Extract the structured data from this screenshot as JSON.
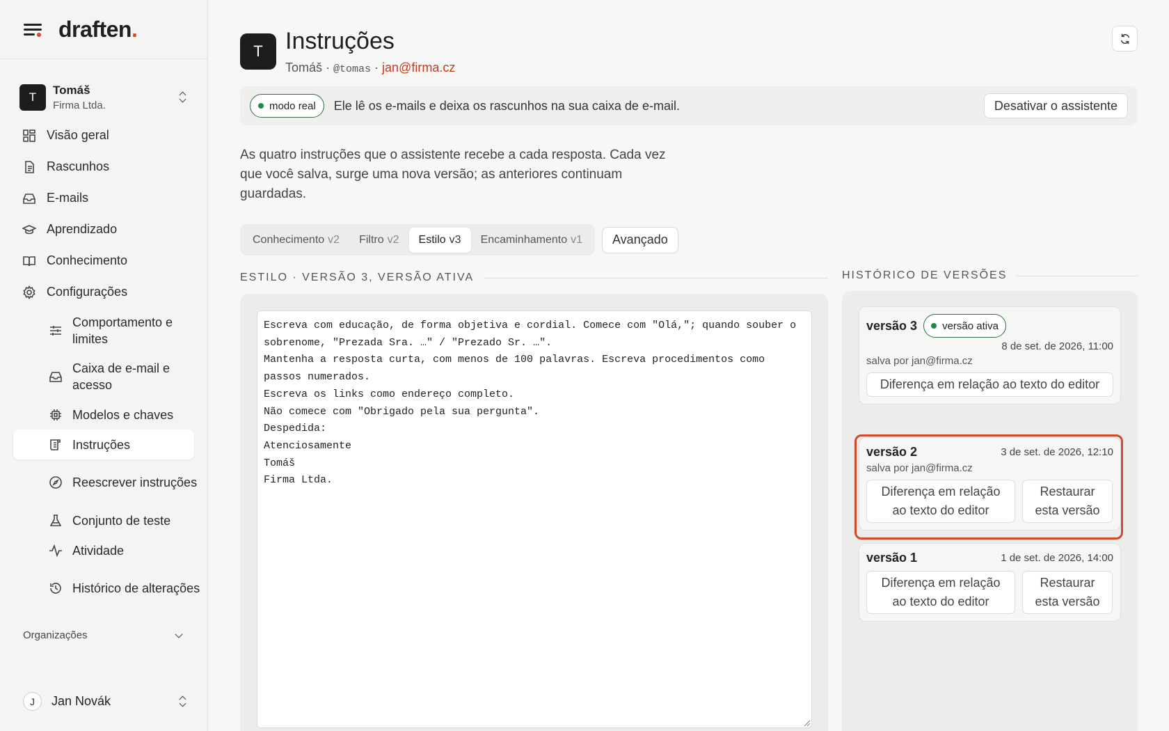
{
  "brand": {
    "name": "draften",
    "dot": "."
  },
  "account": {
    "initial": "T",
    "name": "Tomáš",
    "org": "Firma Ltda."
  },
  "nav": {
    "overview": "Visão geral",
    "drafts": "Rascunhos",
    "emails": "E-mails",
    "learning": "Aprendizado",
    "knowledge": "Conhecimento",
    "settings": "Configurações"
  },
  "subnav": {
    "behavior": "Comportamento e limites",
    "mailbox": "Caixa de e-mail e acesso",
    "models": "Modelos e chaves",
    "instructions": "Instruções",
    "rewrite": "Reescrever instruções",
    "testset": "Conjunto de teste",
    "activity": "Atividade",
    "history": "Histórico de alterações"
  },
  "organizations": "Organizações",
  "user": {
    "initial": "J",
    "name": "Jan Novák"
  },
  "header": {
    "initial": "T",
    "title": "Instruções",
    "name": "Tomáš",
    "separator": " · ",
    "handle": "@tomas",
    "email": "jan@firma.cz"
  },
  "banner": {
    "mode": "modo real",
    "text": "Ele lê os e-mails e deixa os rascunhos na sua caixa de e-mail.",
    "deactivate": "Desativar o assistente",
    "accent": "#1e8a4c"
  },
  "description": "As quatro instruções que o assistente recebe a cada resposta. Cada vez que você salva, surge uma nova versão; as anteriores continuam guardadas.",
  "tabs": [
    {
      "label": "Conhecimento",
      "version": "v2"
    },
    {
      "label": "Filtro",
      "version": "v2"
    },
    {
      "label": "Estilo",
      "version": "v3"
    },
    {
      "label": "Encaminhamento",
      "version": "v1"
    }
  ],
  "advanced": "Avançado",
  "editor": {
    "label": "ESTILO · VERSÃO 3, VERSÃO ATIVA",
    "content": "Escreva com educação, de forma objetiva e cordial. Comece com \"Olá,\"; quando souber o sobrenome, \"Prezada Sra. …\" / \"Prezado Sr. …\".\nMantenha a resposta curta, com menos de 100 palavras. Escreva procedimentos como passos numerados.\nEscreva os links como endereço completo.\nNão comece com \"Obrigado pela sua pergunta\".\nDespedida:\nAtenciosamente\nTomáš\nFirma Ltda."
  },
  "history": {
    "label": "HISTÓRICO DE VERSÕES",
    "highlight_color": "#d24a2c",
    "versions": [
      {
        "name": "versão 3",
        "badge": "versão ativa",
        "date": "8 de set. de 2026, 11:00",
        "by": "salva por jan@firma.cz",
        "diff": "Diferença em relação ao texto do editor"
      },
      {
        "name": "versão 2",
        "date": "3 de set. de 2026, 12:10",
        "by": "salva por jan@firma.cz",
        "diff": "Diferença em relação ao texto do editor",
        "restore": "Restaurar esta versão"
      },
      {
        "name": "versão 1",
        "date": "1 de set. de 2026, 14:00",
        "diff": "Diferença em relação ao texto do editor",
        "restore": "Restaurar esta versão"
      }
    ]
  }
}
